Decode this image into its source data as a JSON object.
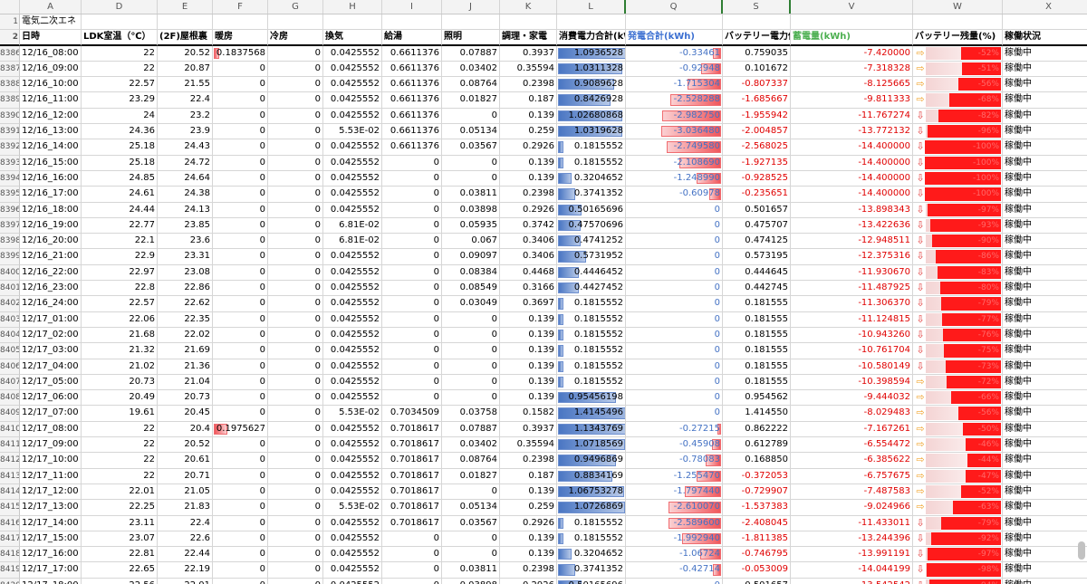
{
  "columns": [
    "A",
    "D",
    "E",
    "F",
    "G",
    "H",
    "I",
    "J",
    "K",
    "L",
    "Q",
    "S",
    "V",
    "W",
    "X"
  ],
  "row1": {
    "num": "1",
    "a": "電気二次エネ"
  },
  "headers": {
    "num": "2",
    "date": "日時",
    "ldk": "LDK室温（℃）",
    "attic": "(2F)屋根裏",
    "heat": "暖房",
    "cool": "冷房",
    "vent": "換気",
    "water": "給湯",
    "light": "照明",
    "cook": "調理・家電",
    "consume": "消費電力合計(kWh)",
    "gen": "発電合計(kWh)",
    "battery_supply": "バッテリー電力供給(kWh)",
    "storage": "蓄電量(kWh)",
    "battery_remain": "バッテリー残量(%)",
    "status": "稼働状況"
  },
  "rows": [
    {
      "n": "8386",
      "d": "12/16_08:00",
      "ldk": "22",
      "att": "20.52",
      "heat": "0.1837568",
      "cool": "0",
      "vent": "0.0425552",
      "wat": "0.6611376",
      "lig": "0.07887",
      "cook": "0.3937",
      "con": "1.0936528",
      "gen": "-0.33461",
      "bs": "0.759035",
      "st": "-7.420000",
      "bp": "-52%",
      "stat": "稼働中",
      "lw": 0.72,
      "qw": 0.12,
      "fw": 0.1,
      "ww": 0.52,
      "arr": "right"
    },
    {
      "n": "8387",
      "d": "12/16_09:00",
      "ldk": "22",
      "att": "20.87",
      "heat": "0",
      "cool": "0",
      "vent": "0.0425552",
      "wat": "0.6611376",
      "lig": "0.03402",
      "cook": "0.35594",
      "con": "1.0311328",
      "gen": "-0.92948",
      "bs": "0.101672",
      "st": "-7.318328",
      "bp": "-51%",
      "stat": "稼働中",
      "lw": 0.68,
      "qw": 0.3,
      "fw": 0,
      "ww": 0.51,
      "arr": "right"
    },
    {
      "n": "8388",
      "d": "12/16_10:00",
      "ldk": "22.57",
      "att": "21.55",
      "heat": "0",
      "cool": "0",
      "vent": "0.0425552",
      "wat": "0.6611376",
      "lig": "0.08764",
      "cook": "0.2398",
      "con": "0.9089628",
      "gen": "-1.715304",
      "bs": "-0.807337",
      "st": "-8.125665",
      "bp": "-56%",
      "stat": "稼働中",
      "lw": 0.6,
      "qw": 0.52,
      "fw": 0,
      "ww": 0.56,
      "arr": "right"
    },
    {
      "n": "8389",
      "d": "12/16_11:00",
      "ldk": "23.29",
      "att": "22.4",
      "heat": "0",
      "cool": "0",
      "vent": "0.0425552",
      "wat": "0.6611376",
      "lig": "0.01827",
      "cook": "0.187",
      "con": "0.8426928",
      "gen": "-2.528288",
      "bs": "-1.685667",
      "st": "-9.811333",
      "bp": "-68%",
      "stat": "稼働中",
      "lw": 0.56,
      "qw": 0.78,
      "fw": 0,
      "ww": 0.68,
      "arr": "right"
    },
    {
      "n": "8390",
      "d": "12/16_12:00",
      "ldk": "24",
      "att": "23.2",
      "heat": "0",
      "cool": "0",
      "vent": "0.0425552",
      "wat": "0.6611376",
      "lig": "0",
      "cook": "0.139",
      "con": "1.02680868",
      "gen": "-2.982750",
      "bs": "-1.955942",
      "st": "-11.767274",
      "bp": "-82%",
      "stat": "稼働中",
      "lw": 0.68,
      "qw": 0.9,
      "fw": 0,
      "ww": 0.82,
      "arr": "down"
    },
    {
      "n": "8391",
      "d": "12/16_13:00",
      "ldk": "24.36",
      "att": "23.9",
      "heat": "0",
      "cool": "0",
      "vent": "5.53E-02",
      "wat": "0.6611376",
      "lig": "0.05134",
      "cook": "0.259",
      "con": "1.0319628",
      "gen": "-3.036480",
      "bs": "-2.004857",
      "st": "-13.772132",
      "bp": "-96%",
      "stat": "稼働中",
      "lw": 0.68,
      "qw": 0.92,
      "fw": 0,
      "ww": 0.96,
      "arr": "down"
    },
    {
      "n": "8392",
      "d": "12/16_14:00",
      "ldk": "25.18",
      "att": "24.43",
      "heat": "0",
      "cool": "0",
      "vent": "0.0425552",
      "wat": "0.6611376",
      "lig": "0.03567",
      "cook": "0.2926",
      "con": "0.1815552",
      "gen": "-2.749580",
      "bs": "-2.568025",
      "st": "-14.400000",
      "bp": "-100%",
      "stat": "稼働中",
      "lw": 0.06,
      "qw": 0.84,
      "fw": 0,
      "ww": 1,
      "arr": "down",
      "sfill": true
    },
    {
      "n": "8393",
      "d": "12/16_15:00",
      "ldk": "25.18",
      "att": "24.72",
      "heat": "0",
      "cool": "0",
      "vent": "0.0425552",
      "wat": "0",
      "lig": "0",
      "cook": "0.139",
      "con": "0.1815552",
      "gen": "-2.108690",
      "bs": "-1.927135",
      "st": "-14.400000",
      "bp": "-100%",
      "stat": "稼働中",
      "lw": 0.06,
      "qw": 0.64,
      "fw": 0,
      "ww": 1,
      "arr": "down",
      "sfill": true
    },
    {
      "n": "8394",
      "d": "12/16_16:00",
      "ldk": "24.85",
      "att": "24.64",
      "heat": "0",
      "cool": "0",
      "vent": "0.0425552",
      "wat": "0",
      "lig": "0",
      "cook": "0.139",
      "con": "0.3204652",
      "gen": "-1.248990",
      "bs": "-0.928525",
      "st": "-14.400000",
      "bp": "-100%",
      "stat": "稼働中",
      "lw": 0.14,
      "qw": 0.38,
      "fw": 0,
      "ww": 1,
      "arr": "down",
      "sfill": true
    },
    {
      "n": "8395",
      "d": "12/16_17:00",
      "ldk": "24.61",
      "att": "24.38",
      "heat": "0",
      "cool": "0",
      "vent": "0.0425552",
      "wat": "0",
      "lig": "0.03811",
      "cook": "0.2398",
      "con": "0.3741352",
      "gen": "-0.60978",
      "bs": "-0.235651",
      "st": "-14.400000",
      "bp": "-100%",
      "stat": "稼働中",
      "lw": 0.18,
      "qw": 0.18,
      "fw": 0,
      "ww": 1,
      "arr": "down",
      "sfill": true
    },
    {
      "n": "8396",
      "d": "12/16_18:00",
      "ldk": "24.44",
      "att": "24.13",
      "heat": "0",
      "cool": "0",
      "vent": "0.0425552",
      "wat": "0",
      "lig": "0.03898",
      "cook": "0.2926",
      "con": "0.50165696",
      "gen": "0",
      "bs": "0.501657",
      "st": "-13.898343",
      "bp": "-97%",
      "stat": "稼働中",
      "lw": 0.25,
      "qw": 0,
      "fw": 0,
      "ww": 0.97,
      "arr": "down"
    },
    {
      "n": "8397",
      "d": "12/16_19:00",
      "ldk": "22.77",
      "att": "23.85",
      "heat": "0",
      "cool": "0",
      "vent": "6.81E-02",
      "wat": "0",
      "lig": "0.05935",
      "cook": "0.3742",
      "con": "0.47570696",
      "gen": "0",
      "bs": "0.475707",
      "st": "-13.422636",
      "bp": "-93%",
      "stat": "稼働中",
      "lw": 0.24,
      "qw": 0,
      "fw": 0,
      "ww": 0.93,
      "arr": "down"
    },
    {
      "n": "8398",
      "d": "12/16_20:00",
      "ldk": "22.1",
      "att": "23.6",
      "heat": "0",
      "cool": "0",
      "vent": "6.81E-02",
      "wat": "0",
      "lig": "0.067",
      "cook": "0.3406",
      "con": "0.4741252",
      "gen": "0",
      "bs": "0.474125",
      "st": "-12.948511",
      "bp": "-90%",
      "stat": "稼働中",
      "lw": 0.24,
      "qw": 0,
      "fw": 0,
      "ww": 0.9,
      "arr": "down"
    },
    {
      "n": "8399",
      "d": "12/16_21:00",
      "ldk": "22.9",
      "att": "23.31",
      "heat": "0",
      "cool": "0",
      "vent": "0.0425552",
      "wat": "0",
      "lig": "0.09097",
      "cook": "0.3406",
      "con": "0.5731952",
      "gen": "0",
      "bs": "0.573195",
      "st": "-12.375316",
      "bp": "-86%",
      "stat": "稼働中",
      "lw": 0.3,
      "qw": 0,
      "fw": 0,
      "ww": 0.86,
      "arr": "down"
    },
    {
      "n": "8400",
      "d": "12/16_22:00",
      "ldk": "22.97",
      "att": "23.08",
      "heat": "0",
      "cool": "0",
      "vent": "0.0425552",
      "wat": "0",
      "lig": "0.08384",
      "cook": "0.4468",
      "con": "0.4446452",
      "gen": "0",
      "bs": "0.444645",
      "st": "-11.930670",
      "bp": "-83%",
      "stat": "稼働中",
      "lw": 0.22,
      "qw": 0,
      "fw": 0,
      "ww": 0.83,
      "arr": "down"
    },
    {
      "n": "8401",
      "d": "12/16_23:00",
      "ldk": "22.8",
      "att": "22.86",
      "heat": "0",
      "cool": "0",
      "vent": "0.0425552",
      "wat": "0",
      "lig": "0.08549",
      "cook": "0.3166",
      "con": "0.4427452",
      "gen": "0",
      "bs": "0.442745",
      "st": "-11.487925",
      "bp": "-80%",
      "stat": "稼働中",
      "lw": 0.22,
      "qw": 0,
      "fw": 0,
      "ww": 0.8,
      "arr": "down"
    },
    {
      "n": "8402",
      "d": "12/16_24:00",
      "ldk": "22.57",
      "att": "22.62",
      "heat": "0",
      "cool": "0",
      "vent": "0.0425552",
      "wat": "0",
      "lig": "0.03049",
      "cook": "0.3697",
      "con": "0.1815552",
      "gen": "0",
      "bs": "0.181555",
      "st": "-11.306370",
      "bp": "-79%",
      "stat": "稼働中",
      "lw": 0.06,
      "qw": 0,
      "fw": 0,
      "ww": 0.79,
      "arr": "down"
    },
    {
      "n": "8403",
      "d": "12/17_01:00",
      "ldk": "22.06",
      "att": "22.35",
      "heat": "0",
      "cool": "0",
      "vent": "0.0425552",
      "wat": "0",
      "lig": "0",
      "cook": "0.139",
      "con": "0.1815552",
      "gen": "0",
      "bs": "0.181555",
      "st": "-11.124815",
      "bp": "-77%",
      "stat": "稼働中",
      "lw": 0.06,
      "qw": 0,
      "fw": 0,
      "ww": 0.77,
      "arr": "down"
    },
    {
      "n": "8404",
      "d": "12/17_02:00",
      "ldk": "21.68",
      "att": "22.02",
      "heat": "0",
      "cool": "0",
      "vent": "0.0425552",
      "wat": "0",
      "lig": "0",
      "cook": "0.139",
      "con": "0.1815552",
      "gen": "0",
      "bs": "0.181555",
      "st": "-10.943260",
      "bp": "-76%",
      "stat": "稼働中",
      "lw": 0.06,
      "qw": 0,
      "fw": 0,
      "ww": 0.76,
      "arr": "down"
    },
    {
      "n": "8405",
      "d": "12/17_03:00",
      "ldk": "21.32",
      "att": "21.69",
      "heat": "0",
      "cool": "0",
      "vent": "0.0425552",
      "wat": "0",
      "lig": "0",
      "cook": "0.139",
      "con": "0.1815552",
      "gen": "0",
      "bs": "0.181555",
      "st": "-10.761704",
      "bp": "-75%",
      "stat": "稼働中",
      "lw": 0.06,
      "qw": 0,
      "fw": 0,
      "ww": 0.75,
      "arr": "down"
    },
    {
      "n": "8406",
      "d": "12/17_04:00",
      "ldk": "21.02",
      "att": "21.36",
      "heat": "0",
      "cool": "0",
      "vent": "0.0425552",
      "wat": "0",
      "lig": "0",
      "cook": "0.139",
      "con": "0.1815552",
      "gen": "0",
      "bs": "0.181555",
      "st": "-10.580149",
      "bp": "-73%",
      "stat": "稼働中",
      "lw": 0.06,
      "qw": 0,
      "fw": 0,
      "ww": 0.73,
      "arr": "down"
    },
    {
      "n": "8407",
      "d": "12/17_05:00",
      "ldk": "20.73",
      "att": "21.04",
      "heat": "0",
      "cool": "0",
      "vent": "0.0425552",
      "wat": "0",
      "lig": "0",
      "cook": "0.139",
      "con": "0.1815552",
      "gen": "0",
      "bs": "0.181555",
      "st": "-10.398594",
      "bp": "-72%",
      "stat": "稼働中",
      "lw": 0.06,
      "qw": 0,
      "fw": 0,
      "ww": 0.72,
      "arr": "right"
    },
    {
      "n": "8408",
      "d": "12/17_06:00",
      "ldk": "20.49",
      "att": "20.73",
      "heat": "0",
      "cool": "0",
      "vent": "0.0425552",
      "wat": "0",
      "lig": "0",
      "cook": "0.139",
      "con": "0.95456198",
      "gen": "0",
      "bs": "0.954562",
      "st": "-9.444032",
      "bp": "-66%",
      "stat": "稼働中",
      "lw": 0.62,
      "qw": 0,
      "fw": 0,
      "ww": 0.66,
      "arr": "right"
    },
    {
      "n": "8409",
      "d": "12/17_07:00",
      "ldk": "19.61",
      "att": "20.45",
      "heat": "0",
      "cool": "0",
      "vent": "5.53E-02",
      "wat": "0.7034509",
      "lig": "0.03758",
      "cook": "0.1582",
      "con": "1.4145496",
      "gen": "0",
      "bs": "1.414550",
      "st": "-8.029483",
      "bp": "-56%",
      "stat": "稼働中",
      "lw": 0.94,
      "qw": 0,
      "fw": 0,
      "ww": 0.56,
      "arr": "right"
    },
    {
      "n": "8410",
      "d": "12/17_08:00",
      "ldk": "22",
      "att": "20.4",
      "heat": "0.1975627",
      "cool": "0",
      "vent": "0.0425552",
      "wat": "0.7018617",
      "lig": "0.07887",
      "cook": "0.3937",
      "con": "1.1343769",
      "gen": "-0.27215",
      "bs": "0.862222",
      "st": "-7.167261",
      "bp": "-50%",
      "stat": "稼働中",
      "lw": 0.75,
      "qw": 0.06,
      "fw": 0.26,
      "ww": 0.5,
      "arr": "right"
    },
    {
      "n": "8411",
      "d": "12/17_09:00",
      "ldk": "22",
      "att": "20.52",
      "heat": "0",
      "cool": "0",
      "vent": "0.0425552",
      "wat": "0.7018617",
      "lig": "0.03402",
      "cook": "0.35594",
      "con": "1.0718569",
      "gen": "-0.45908",
      "bs": "0.612789",
      "st": "-6.554472",
      "bp": "-46%",
      "stat": "稼働中",
      "lw": 0.71,
      "qw": 0.14,
      "fw": 0,
      "ww": 0.46,
      "arr": "right"
    },
    {
      "n": "8412",
      "d": "12/17_10:00",
      "ldk": "22",
      "att": "20.61",
      "heat": "0",
      "cool": "0",
      "vent": "0.0425552",
      "wat": "0.7018617",
      "lig": "0.08764",
      "cook": "0.2398",
      "con": "0.9496869",
      "gen": "-0.78083",
      "bs": "0.168850",
      "st": "-6.385622",
      "bp": "-44%",
      "stat": "稼働中",
      "lw": 0.62,
      "qw": 0.24,
      "fw": 0,
      "ww": 0.44,
      "arr": "right"
    },
    {
      "n": "8413",
      "d": "12/17_11:00",
      "ldk": "22",
      "att": "20.71",
      "heat": "0",
      "cool": "0",
      "vent": "0.0425552",
      "wat": "0.7018617",
      "lig": "0.01827",
      "cook": "0.187",
      "con": "0.8834169",
      "gen": "-1.255470",
      "bs": "-0.372053",
      "st": "-6.757675",
      "bp": "-47%",
      "stat": "稼働中",
      "lw": 0.58,
      "qw": 0.38,
      "fw": 0,
      "ww": 0.47,
      "arr": "right"
    },
    {
      "n": "8414",
      "d": "12/17_12:00",
      "ldk": "22.01",
      "att": "21.05",
      "heat": "0",
      "cool": "0",
      "vent": "0.0425552",
      "wat": "0.7018617",
      "lig": "0",
      "cook": "0.139",
      "con": "1.06753278",
      "gen": "-1.797440",
      "bs": "-0.729907",
      "st": "-7.487583",
      "bp": "-52%",
      "stat": "稼働中",
      "lw": 0.7,
      "qw": 0.55,
      "fw": 0,
      "ww": 0.52,
      "arr": "right"
    },
    {
      "n": "8415",
      "d": "12/17_13:00",
      "ldk": "22.25",
      "att": "21.83",
      "heat": "0",
      "cool": "0",
      "vent": "5.53E-02",
      "wat": "0.7018617",
      "lig": "0.05134",
      "cook": "0.259",
      "con": "1.0726869",
      "gen": "-2.610070",
      "bs": "-1.537383",
      "st": "-9.024966",
      "bp": "-63%",
      "stat": "稼働中",
      "lw": 0.71,
      "qw": 0.8,
      "fw": 0,
      "ww": 0.63,
      "arr": "right"
    },
    {
      "n": "8416",
      "d": "12/17_14:00",
      "ldk": "23.11",
      "att": "22.4",
      "heat": "0",
      "cool": "0",
      "vent": "0.0425552",
      "wat": "0.7018617",
      "lig": "0.03567",
      "cook": "0.2926",
      "con": "0.1815552",
      "gen": "-2.589600",
      "bs": "-2.408045",
      "st": "-11.433011",
      "bp": "-79%",
      "stat": "稼働中",
      "lw": 0.06,
      "qw": 0.8,
      "fw": 0,
      "ww": 0.79,
      "arr": "down"
    },
    {
      "n": "8417",
      "d": "12/17_15:00",
      "ldk": "23.07",
      "att": "22.6",
      "heat": "0",
      "cool": "0",
      "vent": "0.0425552",
      "wat": "0",
      "lig": "0",
      "cook": "0.139",
      "con": "0.1815552",
      "gen": "-1.992940",
      "bs": "-1.811385",
      "st": "-13.244396",
      "bp": "-92%",
      "stat": "稼働中",
      "lw": 0.06,
      "qw": 0.6,
      "fw": 0,
      "ww": 0.92,
      "arr": "down"
    },
    {
      "n": "8418",
      "d": "12/17_16:00",
      "ldk": "22.81",
      "att": "22.44",
      "heat": "0",
      "cool": "0",
      "vent": "0.0425552",
      "wat": "0",
      "lig": "0",
      "cook": "0.139",
      "con": "0.3204652",
      "gen": "-1.06724",
      "bs": "-0.746795",
      "st": "-13.991191",
      "bp": "-97%",
      "stat": "稼働中",
      "lw": 0.14,
      "qw": 0.32,
      "fw": 0,
      "ww": 0.97,
      "arr": "down"
    },
    {
      "n": "8419",
      "d": "12/17_17:00",
      "ldk": "22.65",
      "att": "22.19",
      "heat": "0",
      "cool": "0",
      "vent": "0.0425552",
      "wat": "0",
      "lig": "0.03811",
      "cook": "0.2398",
      "con": "0.3741352",
      "gen": "-0.42714",
      "bs": "-0.053009",
      "st": "-14.044199",
      "bp": "-98%",
      "stat": "稼働中",
      "lw": 0.18,
      "qw": 0.12,
      "fw": 0,
      "ww": 0.98,
      "arr": "down"
    },
    {
      "n": "8420",
      "d": "12/17_18:00",
      "ldk": "22.56",
      "att": "22.01",
      "heat": "0",
      "cool": "0",
      "vent": "0.0425552",
      "wat": "0",
      "lig": "0.03898",
      "cook": "0.2926",
      "con": "0.50165696",
      "gen": "0",
      "bs": "0.501657",
      "st": "-13.542542",
      "bp": "-94%",
      "stat": "稼働中",
      "lw": 0.25,
      "qw": 0,
      "fw": 0,
      "ww": 0.94,
      "arr": "down"
    }
  ]
}
